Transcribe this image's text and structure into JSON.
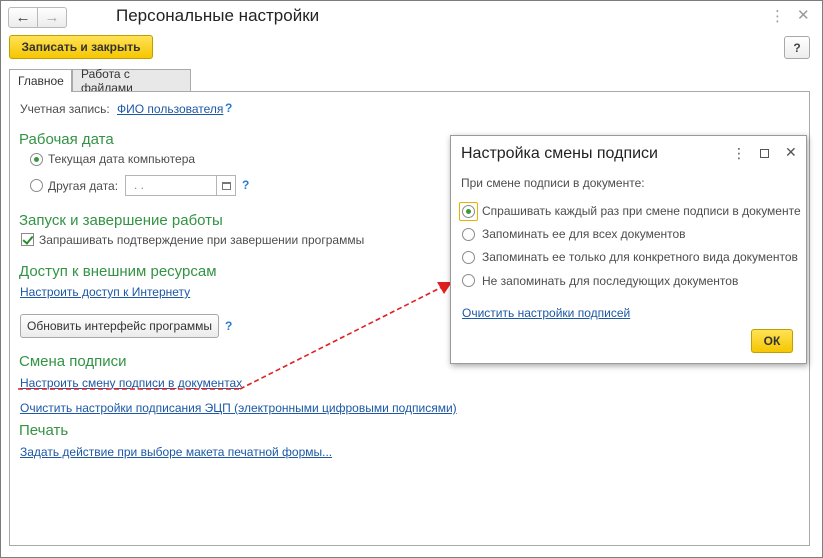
{
  "window": {
    "title": "Персональные настройки",
    "back_icon": "←",
    "forward_icon": "→",
    "more_icon": "⋮",
    "close_icon": "✕"
  },
  "toolbar": {
    "save_close_label": "Записать и закрыть",
    "help_label": "?"
  },
  "tabs": [
    {
      "label": "Главное",
      "active": true
    },
    {
      "label": "Работа с файлами",
      "active": false
    }
  ],
  "account": {
    "label": "Учетная запись:",
    "value": "ФИО пользователя",
    "help": "?"
  },
  "work_date": {
    "heading": "Рабочая дата",
    "option_current": "Текущая дата компьютера",
    "option_other": "Другая дата:",
    "date_placeholder": " .  .",
    "help": "?",
    "selected": "current"
  },
  "startup": {
    "heading": "Запуск и завершение работы",
    "confirm_exit": "Запрашивать подтверждение при завершении программы",
    "confirm_exit_checked": true
  },
  "external": {
    "heading": "Доступ к внешним ресурсам",
    "internet_link": "Настроить доступ к Интернету"
  },
  "update_ui": {
    "button": "Обновить интерфейс программы",
    "help": "?"
  },
  "signature": {
    "heading": "Смена подписи",
    "configure_link": "Настроить смену подписи в документах",
    "clear_ecp_link": "Очистить настройки подписания ЭЦП (электронными цифровыми подписями)"
  },
  "print": {
    "heading": "Печать",
    "action_link": "Задать действие при выборе макета печатной формы..."
  },
  "dialog": {
    "title": "Настройка смены подписи",
    "more_icon": "⋮",
    "close_icon": "✕",
    "prompt": "При смене подписи в документе:",
    "options": [
      {
        "label": "Спрашивать каждый раз при смене подписи в документе",
        "selected": true
      },
      {
        "label": "Запоминать ее для всех документов",
        "selected": false
      },
      {
        "label": "Запоминать ее только для конкретного вида документов",
        "selected": false
      },
      {
        "label": "Не запоминать для последующих документов",
        "selected": false
      }
    ],
    "clear_link": "Очистить настройки подписей",
    "ok_label": "ОК"
  },
  "colors": {
    "accent_yellow": "#f5c600",
    "section_green": "#339344",
    "link_blue": "#1c58a5",
    "arrow_red": "#e02020"
  }
}
